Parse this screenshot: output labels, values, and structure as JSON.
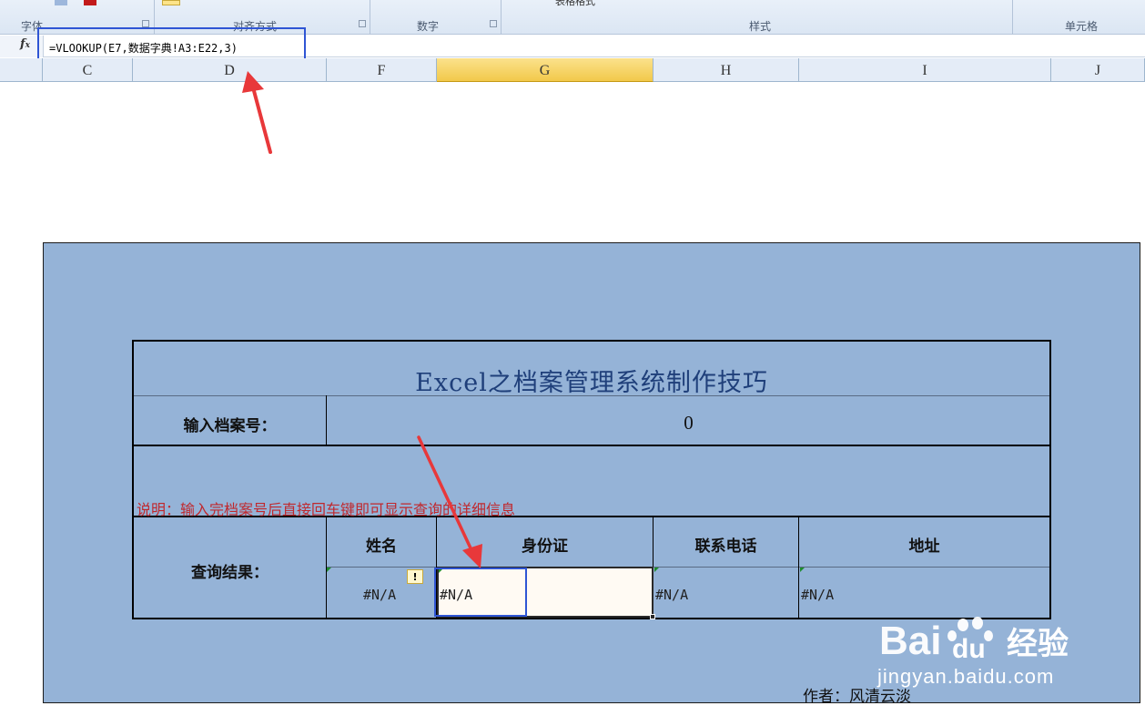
{
  "ribbon": {
    "groups": [
      "字体",
      "对齐方式",
      "数字",
      "样式",
      "单元格"
    ],
    "table_format_label": "表格格式"
  },
  "formula_bar": {
    "fx": "fx",
    "formula": "=VLOOKUP(E7,数据字典!A3:E22,3)"
  },
  "columns": [
    "C",
    "D",
    "F",
    "G",
    "H",
    "I",
    "J"
  ],
  "selected_column": "G",
  "sheet": {
    "title": "Excel之档案管理系统制作技巧",
    "input_label": "输入档案号：",
    "input_value": "0",
    "note": "说明：输入完档案号后直接回车键即可显示查询的详细信息",
    "result_label": "查询结果：",
    "headers": [
      "姓名",
      "身份证",
      "联系电话",
      "地址"
    ],
    "values": [
      "#N/A",
      "#N/A",
      "#N/A",
      "#N/A"
    ],
    "author": "作者：风清云淡"
  },
  "watermark": {
    "logo": "Bai du 经验",
    "url": "jingyan.baidu.com"
  },
  "colors": {
    "panel": "#95b3d7",
    "title": "#1f3f7a",
    "note": "#c0282d",
    "highlight_box": "#2f55d4",
    "arrow": "#e8383a",
    "selected_column": "#f8d567"
  }
}
